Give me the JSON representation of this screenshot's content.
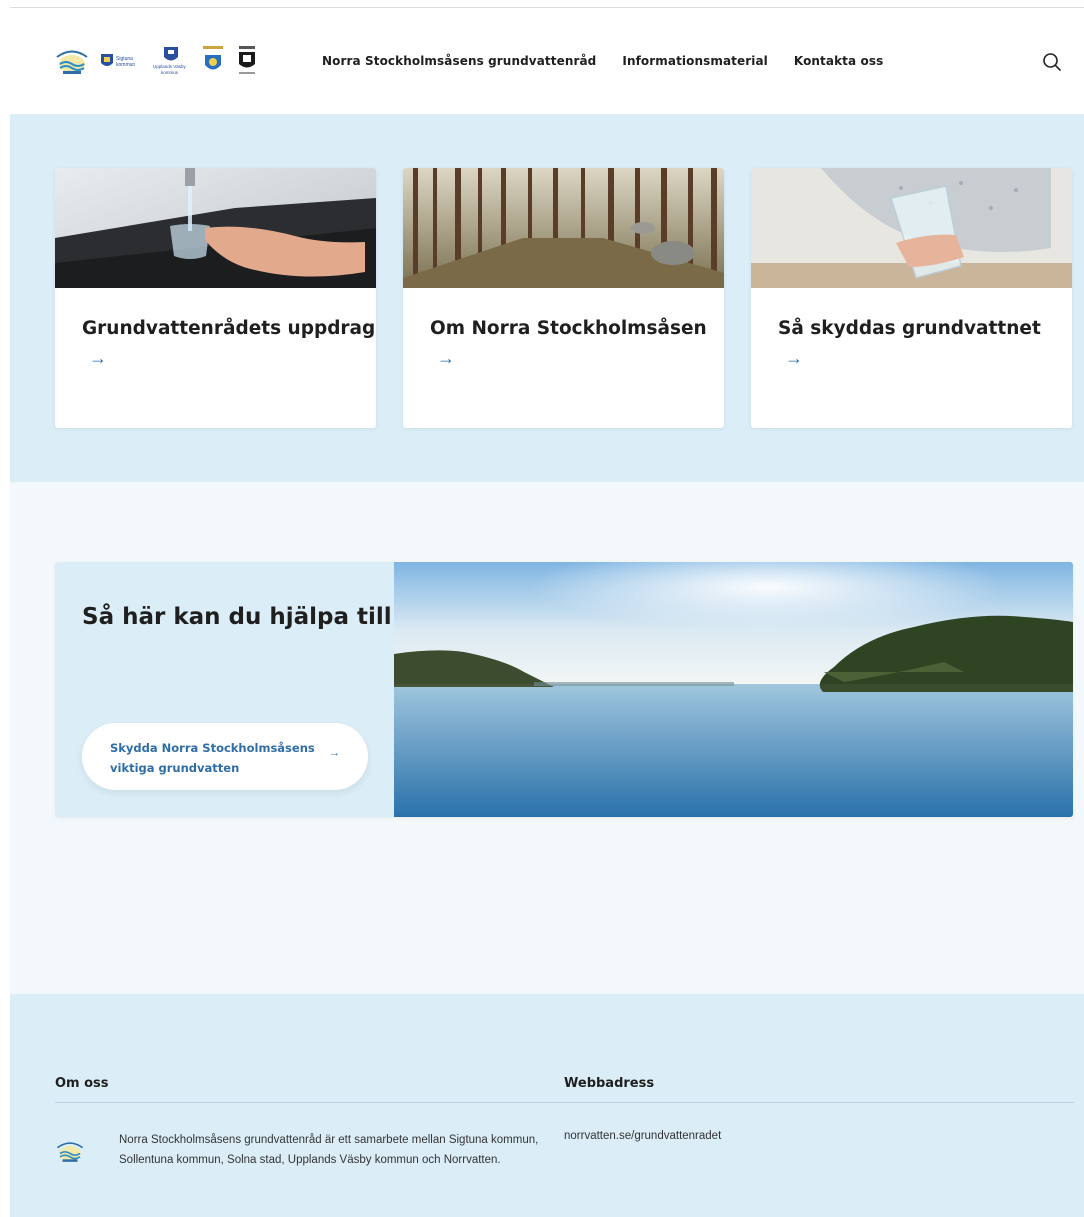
{
  "header": {
    "nav": [
      {
        "label": "Norra Stockholmsåsens grundvattenråd"
      },
      {
        "label": "Informationsmaterial"
      },
      {
        "label": "Kontakta oss"
      }
    ],
    "logo_texts": {
      "sigtuna": [
        "Sigtuna",
        "kommun"
      ],
      "upplands": [
        "Upplands Väsby",
        "kommun"
      ]
    },
    "icons": {
      "search": "search-icon"
    }
  },
  "cards": [
    {
      "title": "Grundvattenrådets uppdrag",
      "arrow": "→"
    },
    {
      "title": "Om Norra Stockholmsåsen",
      "arrow": "→"
    },
    {
      "title": "Så skyddas grundvattnet",
      "arrow": "→"
    }
  ],
  "help": {
    "title": "Så här kan du hjälpa till",
    "button_label": "Skydda Norra Stockholmsåsens viktiga grundvatten",
    "button_arrow": "→"
  },
  "footer": {
    "about_heading": "Om oss",
    "web_heading": "Webbadress",
    "about_text": "Norra Stockholmsåsens grundvattenråd är ett samarbete mellan Sigtuna kommun, Sollentuna kommun, Solna stad, Upplands Väsby kommun och Norrvatten.",
    "web_address": "norrvatten.se/grundvattenradet"
  },
  "colors": {
    "section_bg": "#dbeef7",
    "mid_bg": "#f2f8fb",
    "link_blue": "#2f6da6"
  }
}
